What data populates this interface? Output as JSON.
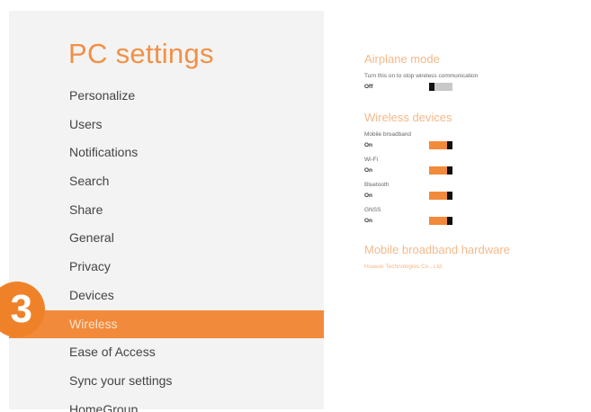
{
  "app": {
    "title": "PC settings"
  },
  "step_badge": "3",
  "nav": {
    "items": [
      {
        "label": "Personalize"
      },
      {
        "label": "Users"
      },
      {
        "label": "Notifications"
      },
      {
        "label": "Search"
      },
      {
        "label": "Share"
      },
      {
        "label": "General"
      },
      {
        "label": "Privacy"
      },
      {
        "label": "Devices"
      },
      {
        "label": "Wireless",
        "selected": true
      },
      {
        "label": "Ease of Access"
      },
      {
        "label": "Sync your settings"
      },
      {
        "label": "HomeGroup"
      }
    ]
  },
  "airplane": {
    "heading": "Airplane mode",
    "description": "Turn this on to stop wireless communication",
    "state": "Off"
  },
  "wireless_devices": {
    "heading": "Wireless devices",
    "devices": [
      {
        "label": "Mobile broadband",
        "state": "On"
      },
      {
        "label": "Wi-Fi",
        "state": "On"
      },
      {
        "label": "Bluetooth",
        "state": "On"
      },
      {
        "label": "GNSS",
        "state": "On"
      }
    ]
  },
  "hardware": {
    "heading": "Mobile broadband hardware",
    "name": "Huawei Technologies Co., Ltd."
  },
  "colors": {
    "accent": "#f28a3b",
    "panel_bg": "#f3f3f3",
    "toggle_off": "#c8c8c8"
  }
}
